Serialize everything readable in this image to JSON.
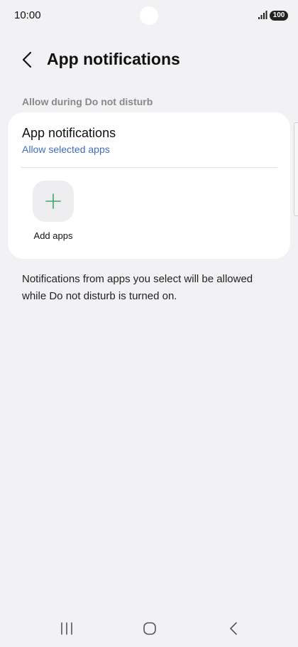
{
  "status_bar": {
    "time": "10:00",
    "battery": "100",
    "signal_icon": "signal-icon"
  },
  "header": {
    "title": "App notifications",
    "back_icon": "chevron-left-icon"
  },
  "section": {
    "label": "Allow during Do not disturb"
  },
  "card": {
    "setting_title": "App notifications",
    "setting_value": "Allow selected apps",
    "add_apps_label": "Add apps",
    "add_icon": "plus-icon"
  },
  "description": "Notifications from apps you select will be allowed while Do not disturb is turned on.",
  "nav_bar": {
    "recent_icon": "recent-apps-icon",
    "home_icon": "home-icon",
    "back_icon": "back-icon"
  },
  "colors": {
    "background": "#f2f2f4",
    "card": "#ffffff",
    "accent_link": "#3e6fbf",
    "plus": "#3fa66a",
    "section_label": "#888888"
  }
}
